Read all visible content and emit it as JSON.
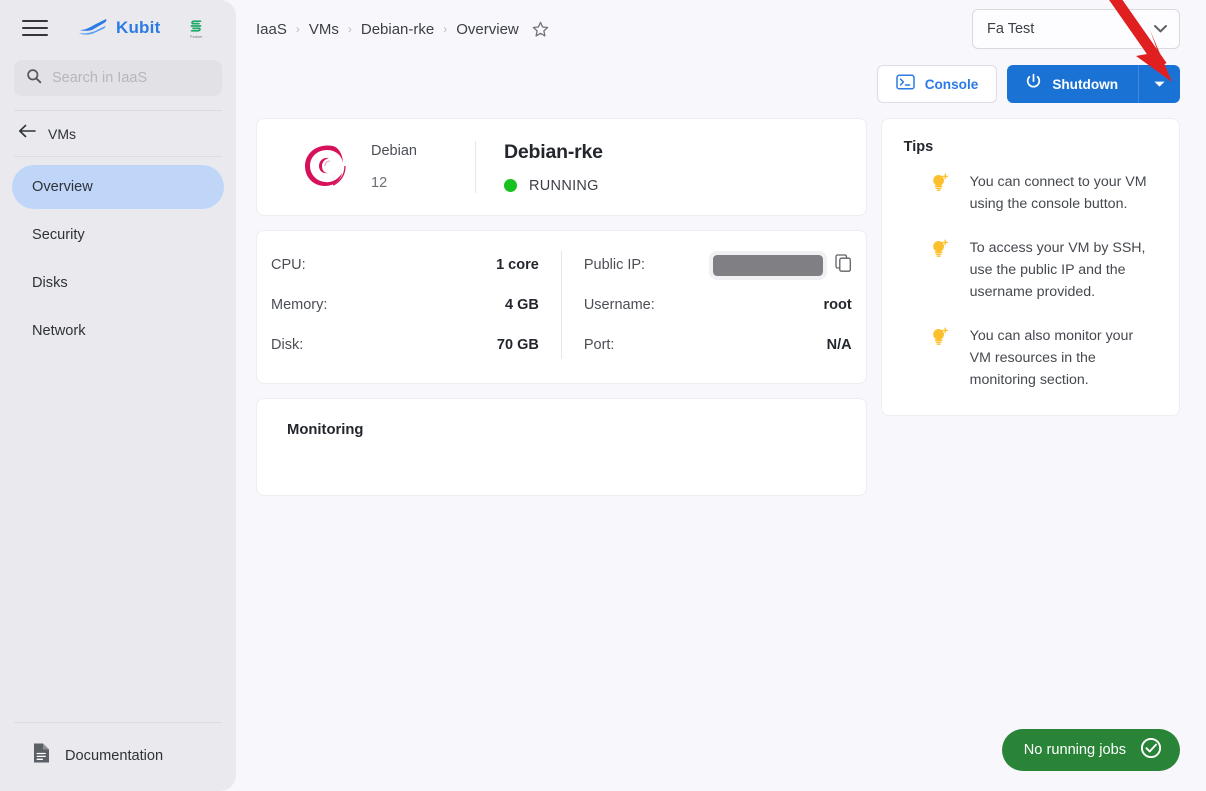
{
  "sidebar": {
    "menu_icon": "hamburger-icon",
    "brand": {
      "name": "Kubit",
      "logo_icon": "kubit-boat-logo"
    },
    "partner": {
      "mark": "S",
      "sub": "Partner"
    },
    "search": {
      "placeholder": "Search in IaaS",
      "value": "",
      "icon": "search-icon"
    },
    "back": {
      "label": "VMs",
      "icon": "arrow-left-icon"
    },
    "items": [
      {
        "label": "Overview",
        "active": true
      },
      {
        "label": "Security",
        "active": false
      },
      {
        "label": "Disks",
        "active": false
      },
      {
        "label": "Network",
        "active": false
      }
    ],
    "documentation": {
      "label": "Documentation",
      "icon": "document-icon"
    }
  },
  "topbar": {
    "breadcrumb": [
      {
        "label": "IaaS"
      },
      {
        "label": "VMs"
      },
      {
        "label": "Debian-rke"
      },
      {
        "label": "Overview"
      }
    ],
    "separator": "›",
    "favorite_icon": "star-outline-icon",
    "account_select": {
      "value": "Fa Test",
      "caret_icon": "chevron-down-icon"
    }
  },
  "actions": {
    "console": {
      "label": "Console",
      "icon": "terminal-icon"
    },
    "shutdown": {
      "label": "Shutdown",
      "icon": "power-icon",
      "caret_icon": "chevron-down-icon"
    }
  },
  "vm": {
    "os": {
      "name": "Debian",
      "version": "12",
      "logo_icon": "debian-swirl-logo"
    },
    "name": "Debian-rke",
    "status": {
      "label": "RUNNING",
      "color": "#17c11f"
    },
    "specs_left": [
      {
        "key": "CPU:",
        "value": "1 core"
      },
      {
        "key": "Memory:",
        "value": "4 GB"
      },
      {
        "key": "Disk:",
        "value": "70 GB"
      }
    ],
    "specs_right": [
      {
        "key": "Public IP:",
        "value": "",
        "redacted": true,
        "copy_icon": "copy-icon"
      },
      {
        "key": "Username:",
        "value": "root"
      },
      {
        "key": "Port:",
        "value": "N/A"
      }
    ]
  },
  "monitoring": {
    "title": "Monitoring"
  },
  "tips": {
    "title": "Tips",
    "icon": "lightbulb-icon",
    "items": [
      "You can connect to your VM using the console button.",
      "To access your VM by SSH, use the public IP and the username provided.",
      "You can also monitor your VM resources in the monitoring section."
    ]
  },
  "jobs": {
    "label": "No running jobs",
    "icon": "check-circle-icon"
  },
  "annotation": {
    "type": "red-arrow",
    "color": "#e02020",
    "points_to": "shutdown-dropdown-caret"
  },
  "colors": {
    "brand_blue": "#2c7be5",
    "primary_button": "#1a73d4",
    "active_nav": "#bfd6f9",
    "status_green": "#17c11f",
    "jobs_green": "#2a8438",
    "tip_amber": "#fcc02e",
    "debian_crimson": "#d6105a",
    "sidebar_bg": "#eaeaee",
    "page_bg": "#f8f8fc"
  }
}
